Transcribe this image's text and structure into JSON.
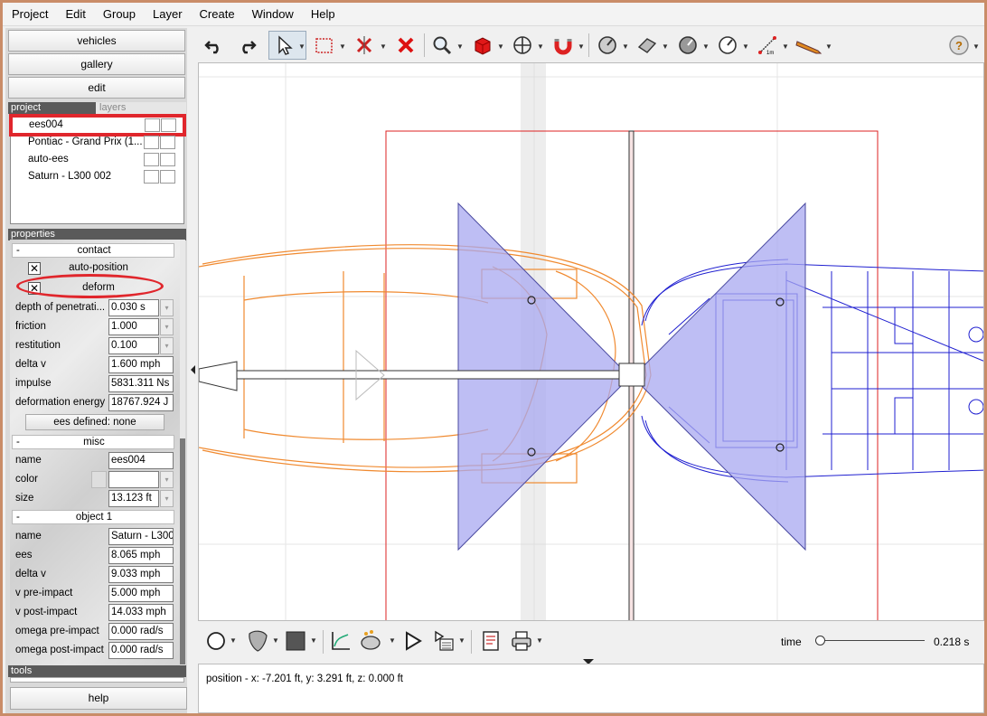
{
  "menubar": {
    "items": [
      "Project",
      "Edit",
      "Group",
      "Layer",
      "Create",
      "Window",
      "Help"
    ]
  },
  "nav": {
    "vehicles": "vehicles",
    "gallery": "gallery",
    "edit": "edit",
    "help": "help"
  },
  "project_panel": {
    "tab_project": "project",
    "tab_layers": "layers",
    "items": [
      "ees004",
      "Pontiac - Grand Prix (1...",
      "auto-ees",
      "Saturn - L300 002"
    ],
    "selected_index": 0
  },
  "properties": {
    "title": "properties",
    "contact": {
      "header": "contact",
      "auto_position_label": "auto-position",
      "auto_position_checked": true,
      "deform_label": "deform",
      "deform_checked": true,
      "depth_label": "depth of penetrati...",
      "depth_value": "0.030 s",
      "friction_label": "friction",
      "friction_value": "1.000",
      "restitution_label": "restitution",
      "restitution_value": "0.100",
      "delta_v_label": "delta v",
      "delta_v_value": "1.600 mph",
      "impulse_label": "impulse",
      "impulse_value": "5831.311 Ns",
      "def_energy_label": "deformation energy",
      "def_energy_value": "18767.924 J",
      "ees_button": "ees defined: none"
    },
    "misc": {
      "header": "misc",
      "name_label": "name",
      "name_value": "ees004",
      "color_label": "color",
      "size_label": "size",
      "size_value": "13.123 ft"
    },
    "object1": {
      "header": "object 1",
      "name_label": "name",
      "name_value": "Saturn - L300",
      "ees_label": "ees",
      "ees_value": "8.065 mph",
      "delta_v_label": "delta v",
      "delta_v_value": "9.033 mph",
      "v_pre_label": "v pre-impact",
      "v_pre_value": "5.000 mph",
      "v_post_label": "v post-impact",
      "v_post_value": "14.033 mph",
      "omega_pre_label": "omega pre-impact",
      "omega_pre_value": "0.000 rad/s",
      "omega_post_label": "omega post-impact",
      "omega_post_value": "0.000 rad/s"
    }
  },
  "tools_label": "tools",
  "time": {
    "label": "time",
    "value": "0.218 s",
    "slider_fraction": 0.0
  },
  "status": {
    "position_text": "position - x: -7.201 ft, y: 3.291 ft, z: 0.000 ft"
  },
  "colors": {
    "accent_red": "#e0262c",
    "vehicle1": "#f08a30",
    "vehicle2": "#1f1fd0",
    "deform_triangle": "#a8a8f0"
  }
}
